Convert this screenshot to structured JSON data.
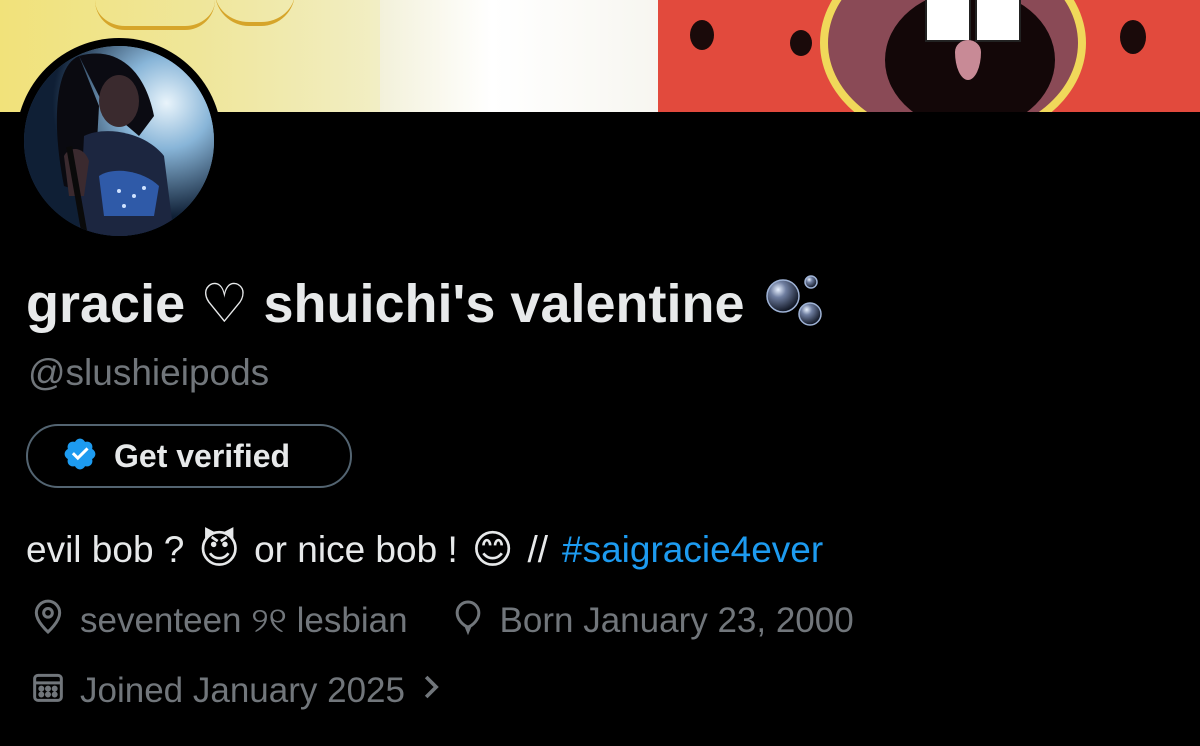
{
  "profile": {
    "display_name": "gracie ♡ shuichi's valentine",
    "handle": "@slushieipods",
    "verify_button_label": "Get verified",
    "bio": {
      "part1": "evil bob ?",
      "emoji1": "😈",
      "part2": "or nice bob !",
      "emoji2": "😊",
      "separator": "//",
      "hashtag": "#saigracie4ever"
    },
    "location": "seventeen ୨୧ lesbian",
    "birthday": "Born January 23, 2000",
    "joined": "Joined January 2025"
  },
  "icons": {
    "name_badge": "bubbles-icon",
    "verify": "verified-badge-icon",
    "location": "location-pin-icon",
    "birthday": "balloon-icon",
    "joined": "calendar-icon",
    "joined_more": "chevron-right-icon"
  },
  "colors": {
    "background": "#000000",
    "primary_text": "#e7e9ea",
    "secondary_text": "#71767b",
    "link": "#1d9bf0",
    "verify_blue": "#1d9bf0",
    "button_border": "#536471"
  }
}
